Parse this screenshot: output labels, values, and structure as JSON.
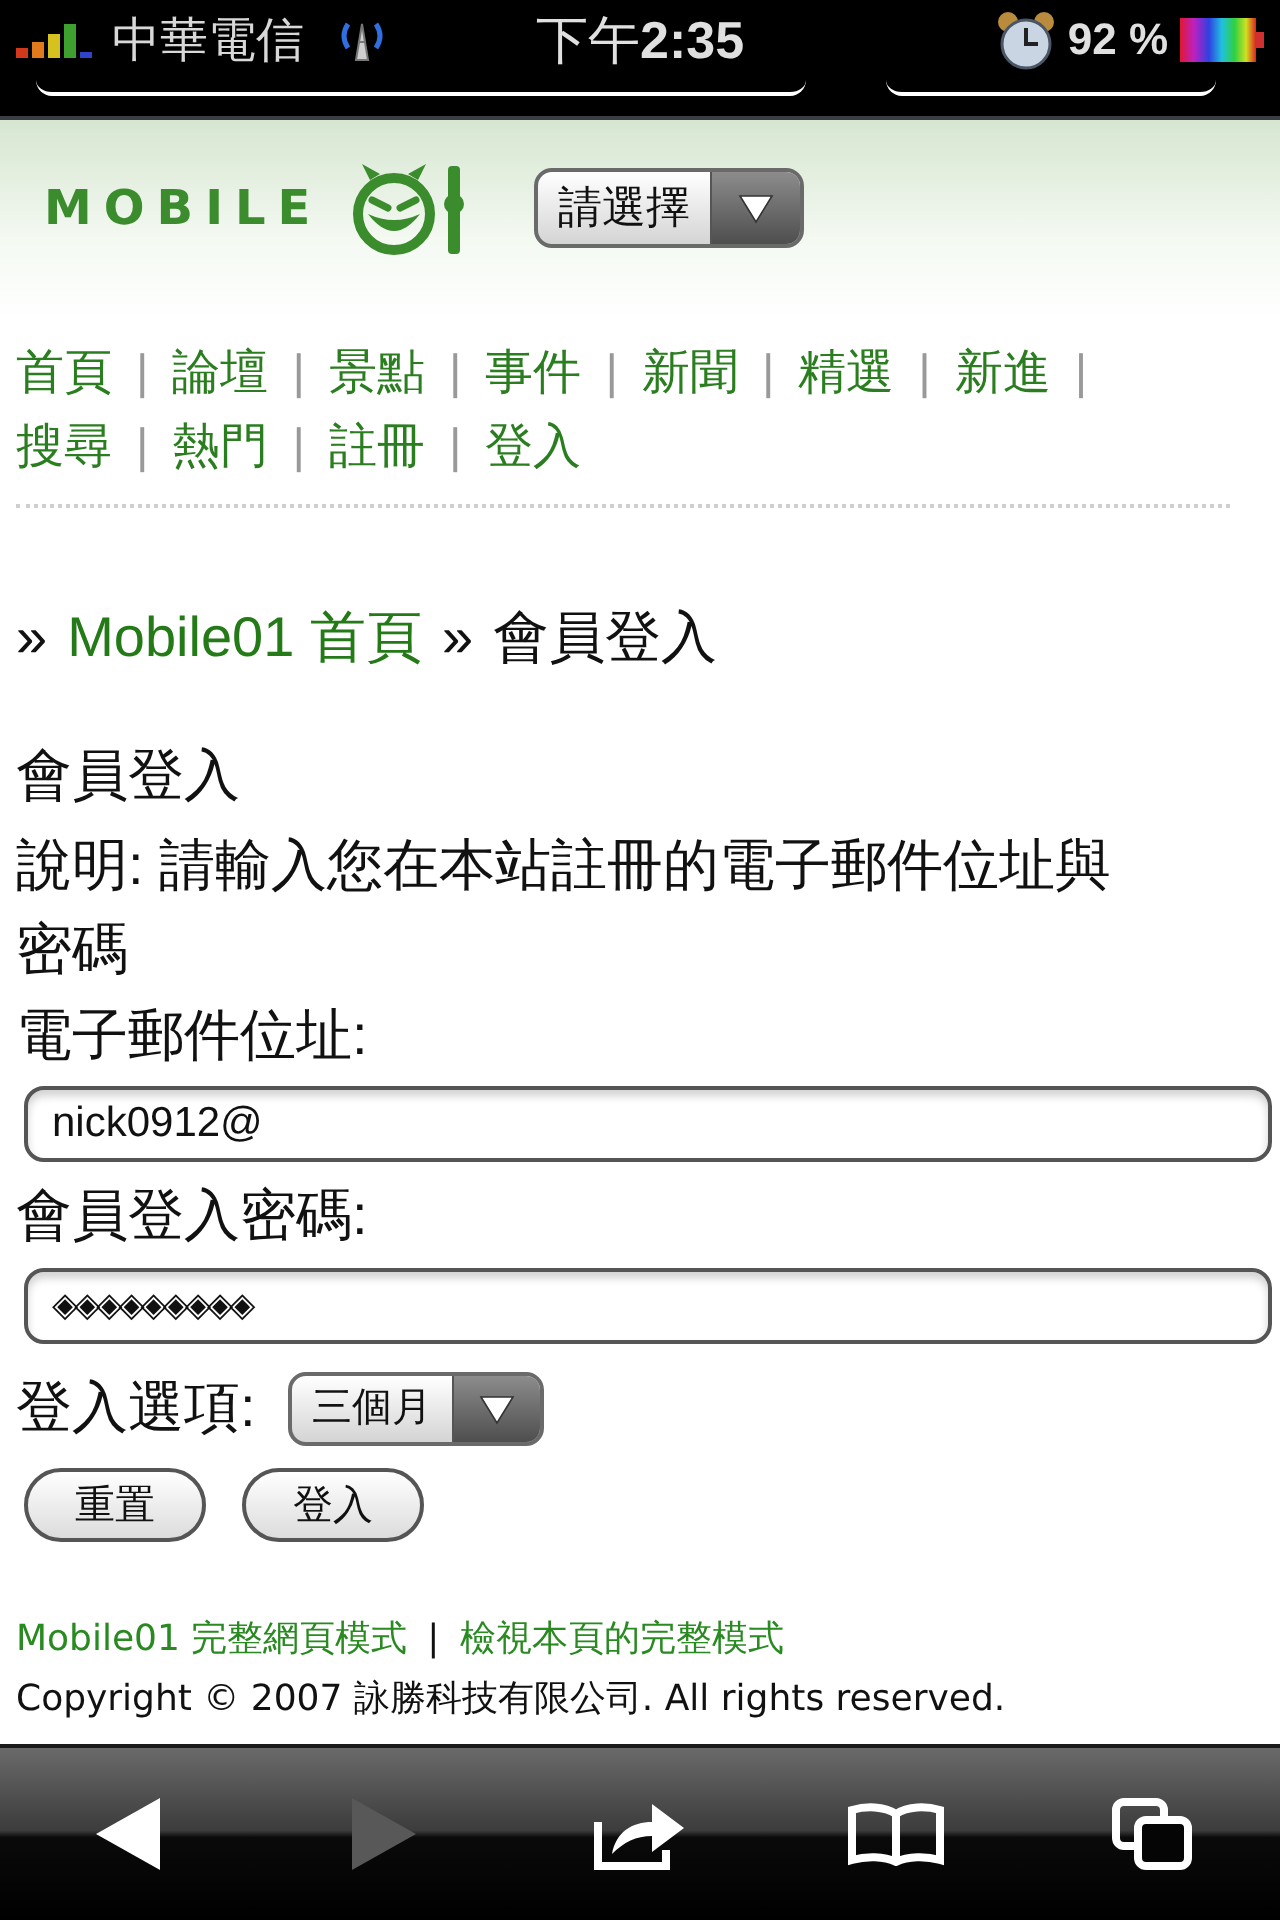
{
  "status_bar": {
    "carrier": "中華電信",
    "time": "下午**2:35**",
    "battery": "92 %"
  },
  "header": {
    "logo": "MOBILE",
    "category_select": {
      "value": "請選擇"
    }
  },
  "nav": [
    {
      "kind": "link",
      "text": "首頁"
    },
    {
      "kind": "separator",
      "text": "|"
    },
    {
      "kind": "link",
      "text": "論壇"
    },
    {
      "kind": "separator",
      "text": "|"
    },
    {
      "kind": "link",
      "text": "景點"
    },
    {
      "kind": "separator",
      "text": "|"
    },
    {
      "kind": "link",
      "text": "事件"
    },
    {
      "kind": "separator",
      "text": "|"
    },
    {
      "kind": "link",
      "text": "新聞"
    },
    {
      "kind": "separator",
      "text": "|"
    },
    {
      "kind": "link",
      "text": "精選"
    },
    {
      "kind": "separator",
      "text": "|"
    },
    {
      "kind": "link",
      "text": "新進"
    },
    {
      "kind": "separator",
      "text": "|"
    },
    {
      "kind": "link",
      "text": "搜尋"
    },
    {
      "kind": "separator",
      "text": "|"
    },
    {
      "kind": "link",
      "text": "熱門"
    },
    {
      "kind": "separator",
      "text": "|"
    },
    {
      "kind": "link",
      "text": "註冊"
    },
    {
      "kind": "separator",
      "text": "|"
    },
    {
      "kind": "link",
      "text": "登入"
    }
  ],
  "breadcrumb": [
    {
      "kind": "separator",
      "text": "»"
    },
    {
      "kind": "link",
      "text": "Mobile01 首頁"
    },
    {
      "kind": "separator",
      "text": "»"
    },
    {
      "kind": "current",
      "text": "會員登入"
    }
  ],
  "form": {
    "title": "會員登入",
    "description": "說明: 請輸入您在本站註冊的電子郵件位址與密碼",
    "fields": [
      {
        "kind": "email",
        "label": "電子郵件位址:",
        "value": "nick0912@"
      },
      {
        "kind": "password",
        "label": "會員登入密碼:",
        "value": "◈◈◈◈◈◈◈◈◈"
      }
    ],
    "option": {
      "label": "登入選項:",
      "value": "三個月"
    },
    "buttons": [
      "重置",
      "登入"
    ]
  },
  "footer": {
    "links": [
      {
        "kind": "link",
        "text": "Mobile01 完整網頁模式"
      },
      {
        "kind": "separator",
        "text": "|"
      },
      {
        "kind": "link",
        "text": "檢視本頁的完整模式"
      }
    ],
    "copyright": "Copyright © 2007 詠勝科技有限公司. All rights reserved."
  },
  "toolbar": [
    {
      "kind": "back",
      "disabled": false
    },
    {
      "kind": "forward",
      "disabled": true
    },
    {
      "kind": "share",
      "disabled": false
    },
    {
      "kind": "bookmarks",
      "disabled": false
    },
    {
      "kind": "tabs",
      "disabled": false
    }
  ]
}
